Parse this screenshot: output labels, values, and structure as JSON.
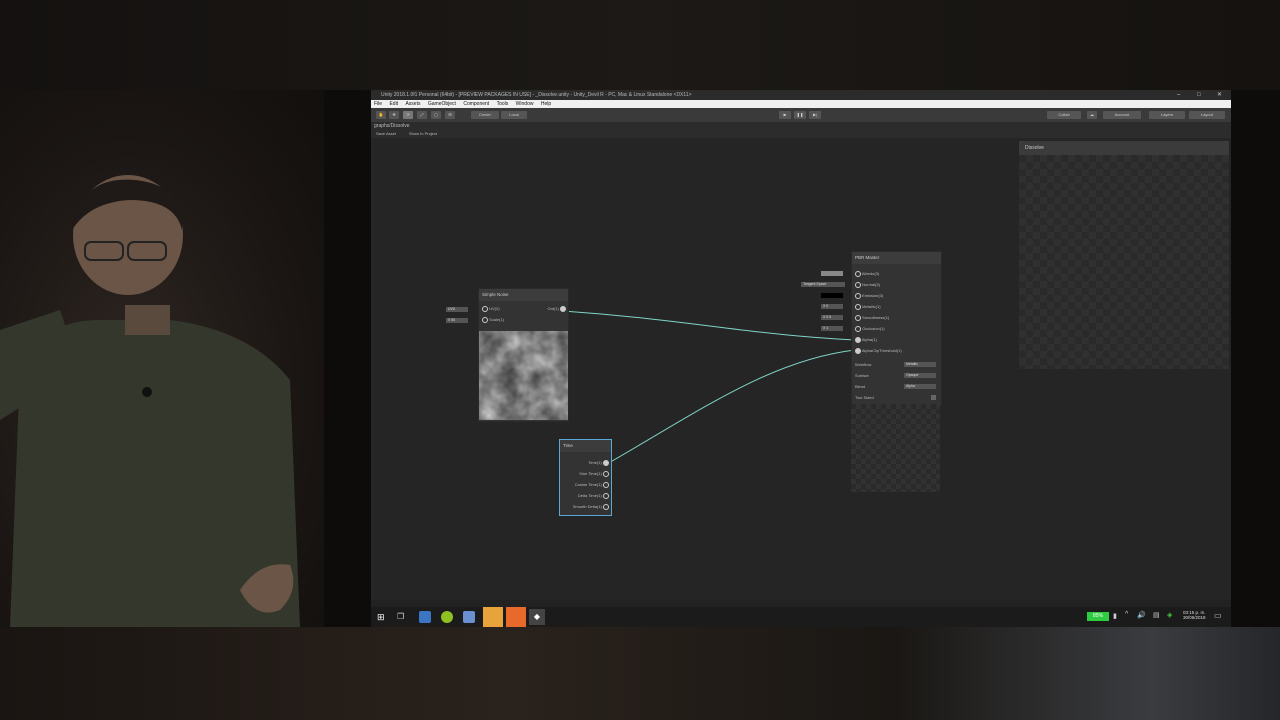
{
  "window": {
    "title": "Unity 2018.1.0f1 Personal (64bit) - [PREVIEW PACKAGES IN USE] - _Dissolve.unity - Unity_Devil R - PC, Mac & Linux Standalone <DX11>",
    "controls": [
      "–",
      "□",
      "✕"
    ]
  },
  "menu": [
    "File",
    "Edit",
    "Assets",
    "GameObject",
    "Component",
    "Tools",
    "Window",
    "Help"
  ],
  "toolbar": {
    "center_label": "Center",
    "local_label": "Local",
    "collab_label": "Collab",
    "account_label": "Account",
    "layers_label": "Layers",
    "layout_label": "Layout"
  },
  "graph_tabs": {
    "path": "graphs/Dissolve",
    "save_asset": "Save Asset",
    "show_in_project": "Show In Project"
  },
  "nodes": {
    "simple_noise": {
      "title": "Simple Noise",
      "inputs": [
        "UV(2)",
        "Scale(1)"
      ],
      "input_values": [
        "UV0",
        "X 50"
      ],
      "output": "Out(1)"
    },
    "time": {
      "title": "Time",
      "outputs": [
        "Time(1)",
        "Sine Time(1)",
        "Cosine Time(1)",
        "Delta Time(1)",
        "Smooth Delta(1)"
      ]
    },
    "pbr_master": {
      "title": "PBR Master",
      "inputs": [
        "Albedo(3)",
        "Normal(3)",
        "Emission(3)",
        "Metallic(1)",
        "Smoothness(1)",
        "Occlusion(1)",
        "Alpha(1)",
        "AlphaClipThreshold(1)"
      ],
      "input_values": [
        "",
        "Tangent Space",
        "",
        "X 0",
        "X 0.5",
        "X 1"
      ],
      "settings": [
        {
          "label": "Workflow",
          "value": "Metallic"
        },
        {
          "label": "Surface",
          "value": "Opaque"
        },
        {
          "label": "Blend",
          "value": "Alpha"
        },
        {
          "label": "Two Sided",
          "value": ""
        }
      ]
    }
  },
  "preview": {
    "title": "Dissolve"
  },
  "taskbar": {
    "battery": "85%",
    "time": "03:15 p. m.",
    "date": "30/06/2018"
  },
  "colors": {
    "edge": "#7fd4c8",
    "node_bg": "#333333",
    "canvas_bg": "#252525",
    "battery_green": "#2ecc40"
  }
}
